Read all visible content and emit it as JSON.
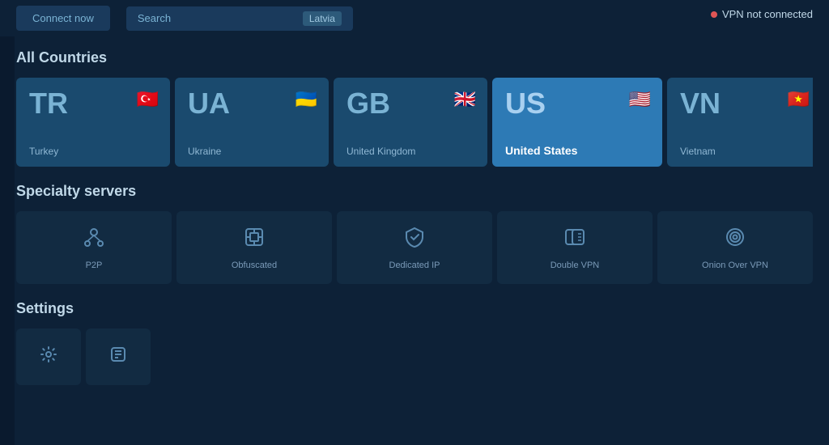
{
  "header": {
    "connect_button": "Connect now",
    "search_label": "Search",
    "search_value": "Latvia",
    "vpn_status": "VPN not connected"
  },
  "all_countries": {
    "title": "All Countries",
    "countries": [
      {
        "code": "TR",
        "name": "Turkey",
        "flag": "🇹🇷"
      },
      {
        "code": "UA",
        "name": "Ukraine",
        "flag": "🇺🇦"
      },
      {
        "code": "GB",
        "name": "United Kingdom",
        "flag": "🇬🇧"
      },
      {
        "code": "US",
        "name": "United States",
        "flag": "🇺🇸",
        "active": true
      },
      {
        "code": "VN",
        "name": "Vietnam",
        "flag": "🇻🇳"
      }
    ]
  },
  "specialty_servers": {
    "title": "Specialty servers",
    "items": [
      {
        "id": "p2p",
        "label": "P2P"
      },
      {
        "id": "obfuscated",
        "label": "Obfuscated"
      },
      {
        "id": "dedicated",
        "label": "Dedicated IP"
      },
      {
        "id": "double-vpn",
        "label": "Double VPN"
      },
      {
        "id": "onion",
        "label": "Onion Over VPN"
      }
    ]
  },
  "settings": {
    "title": "Settings"
  },
  "colors": {
    "bg_dark": "#0d2137",
    "bg_card": "#1a4a6e",
    "bg_card_active": "#2d7ab5",
    "accent": "#e05555",
    "text_muted": "#7ab3d4"
  }
}
